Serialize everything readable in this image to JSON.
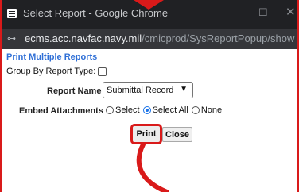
{
  "window": {
    "title": "Select Report - Google Chrome",
    "minimize_glyph": "—",
    "maximize_glyph": "☐",
    "close_glyph": "✕"
  },
  "address_bar": {
    "site_icon": "site-info-icon",
    "host": "ecms.acc.navfac.navy.mil",
    "path": "/cmicprod/SysReportPopup/showR..."
  },
  "form": {
    "heading": "Print Multiple Reports",
    "group_by_label": "Group By Report Type:",
    "group_by_checked": false,
    "report_name_label": "Report Name",
    "report_name_value": "Submittal Record",
    "embed_label": "Embed Attachments",
    "embed_options": [
      {
        "label": "Select",
        "selected": false
      },
      {
        "label": "Select All",
        "selected": true
      },
      {
        "label": "None",
        "selected": false
      }
    ],
    "print_label": "Print",
    "close_label": "Close"
  },
  "colors": {
    "highlight": "#d91a1a",
    "heading": "#2f6fd6",
    "titlebar": "#202124",
    "addressbar": "#35363a"
  }
}
